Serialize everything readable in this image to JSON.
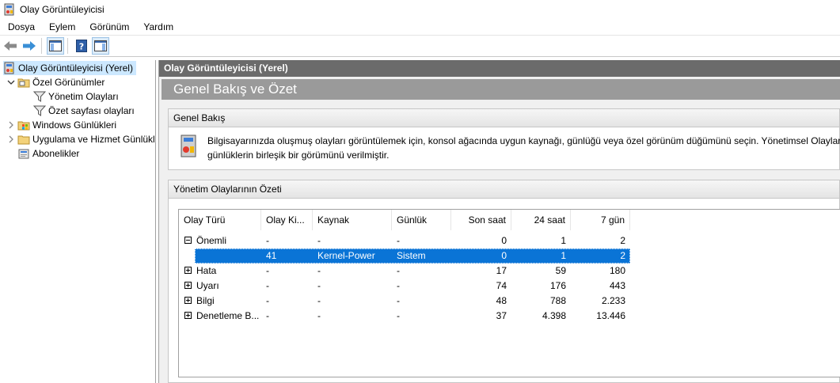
{
  "window": {
    "title": "Olay Görüntüleyicisi"
  },
  "menu": [
    "Dosya",
    "Eylem",
    "Görünüm",
    "Yardım"
  ],
  "toolbar": {
    "icons": [
      "back-arrow-icon",
      "forward-arrow-icon",
      "show-hide-console-tree-icon",
      "help-icon",
      "show-hide-action-pane-icon"
    ]
  },
  "tree": {
    "root": "Olay Görüntüleyicisi (Yerel)",
    "custom_views": "Özel Görünümler",
    "admin_events": "Yönetim Olayları",
    "summary_events": "Özet sayfası olayları",
    "windows_logs": "Windows Günlükleri",
    "app_service_logs": "Uygulama ve Hizmet Günlükl",
    "subscriptions": "Abonelikler"
  },
  "content": {
    "pane_header": "Olay Görüntüleyicisi (Yerel)",
    "big_header": "Genel Bakış ve Özet",
    "overview": {
      "title": "Genel Bakış",
      "text_line1": "Bilgisayarınızda oluşmuş olayları görüntülemek için, konsol ağacında uygun kaynağı, günlüğü veya özel görünüm düğümünü seçin. Yönetimsel Olaylar",
      "text_line2": "günlüklerin birleşik bir görümünü verilmiştir."
    },
    "summary": {
      "title": "Yönetim Olaylarının Özeti",
      "columns": [
        "Olay Türü",
        "Olay Ki...",
        "Kaynak",
        "Günlük",
        "Son saat",
        "24 saat",
        "7 gün"
      ],
      "rows": [
        {
          "type": "Önemli",
          "expander": "minus",
          "id": "-",
          "source": "-",
          "log": "-",
          "last_hour": "0",
          "h24": "1",
          "d7": "2"
        },
        {
          "type": "",
          "expander": "",
          "id": "41",
          "source": "Kernel-Power",
          "log": "Sistem",
          "last_hour": "0",
          "h24": "1",
          "d7": "2",
          "selected": true
        },
        {
          "type": "Hata",
          "expander": "plus",
          "id": "-",
          "source": "-",
          "log": "-",
          "last_hour": "17",
          "h24": "59",
          "d7": "180"
        },
        {
          "type": "Uyarı",
          "expander": "plus",
          "id": "-",
          "source": "-",
          "log": "-",
          "last_hour": "74",
          "h24": "176",
          "d7": "443"
        },
        {
          "type": "Bilgi",
          "expander": "plus",
          "id": "-",
          "source": "-",
          "log": "-",
          "last_hour": "48",
          "h24": "788",
          "d7": "2.233"
        },
        {
          "type": "Denetleme B...",
          "expander": "plus",
          "id": "-",
          "source": "-",
          "log": "-",
          "last_hour": "37",
          "h24": "4.398",
          "d7": "13.446"
        }
      ]
    }
  },
  "colors": {
    "selection": "#0a74d6",
    "tree_selection": "#cce8ff",
    "pane_header": "#6b6b6b",
    "big_header": "#9a9a9a"
  }
}
